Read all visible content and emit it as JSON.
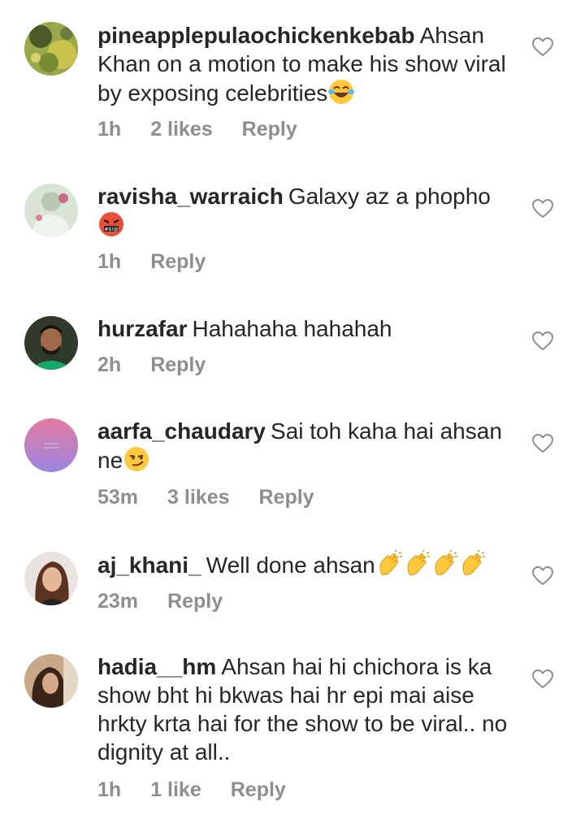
{
  "comments": [
    {
      "username": "pineapplepulaochickenkebab",
      "text": "Ahsan Khan on a motion to make his show viral by exposing celebrities",
      "emoji": "joy-emoji",
      "time": "1h",
      "likes": "2 likes",
      "reply": "Reply",
      "avatar": "avatar-yellow-green-photo"
    },
    {
      "username": "ravisha_warraich",
      "text": "Galaxy az a phopho",
      "emoji": "cursing-face-emoji",
      "time": "1h",
      "likes": "",
      "reply": "Reply",
      "avatar": "avatar-pale-green-photo"
    },
    {
      "username": "hurzafar",
      "text": "Hahahaha hahahah",
      "emoji": "",
      "time": "2h",
      "likes": "",
      "reply": "Reply",
      "avatar": "avatar-man-photo"
    },
    {
      "username": "aarfa_chaudary",
      "text": "Sai toh kaha hai ahsan ne",
      "emoji": "smirk-emoji",
      "time": "53m",
      "likes": "3 likes",
      "reply": "Reply",
      "avatar": "avatar-pink-purple-gradient"
    },
    {
      "username": "aj_khani_",
      "text": "Well done ahsan",
      "emoji": "clapping-hands-emoji-x4",
      "time": "23m",
      "likes": "",
      "reply": "Reply",
      "avatar": "avatar-woman-photo"
    },
    {
      "username": "hadia__hm",
      "text": "Ahsan hai hi chichora is ka show bht hi bkwas hai hr epi mai aise hrkty krta hai for the show to be viral.. no dignity at all..",
      "emoji": "",
      "time": "1h",
      "likes": "1 like",
      "reply": "Reply",
      "avatar": "avatar-woman-dark-photo"
    }
  ],
  "colors": {
    "text": "#262626",
    "meta": "#8e8e8e",
    "emoji_yellow": "#FFC83D"
  }
}
